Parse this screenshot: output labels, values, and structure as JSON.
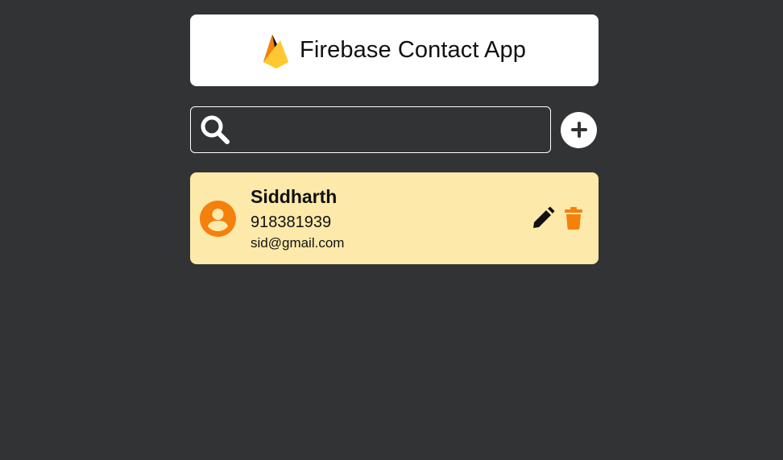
{
  "header": {
    "logo_icon": "firebase-flame-icon",
    "title": "Firebase Contact App"
  },
  "search": {
    "icon": "search-icon",
    "value": "",
    "placeholder": ""
  },
  "add_button": {
    "icon": "plus-circle-icon"
  },
  "contacts": [
    {
      "name": "Siddharth",
      "phone": "918381939",
      "email": "sid@gmail.com",
      "avatar_icon": "user-circle-icon",
      "edit_icon": "pencil-icon",
      "delete_icon": "trash-icon"
    }
  ],
  "colors": {
    "background": "#323334",
    "card": "#fde9aa",
    "accent": "#f5800b",
    "header_bg": "#ffffff"
  }
}
